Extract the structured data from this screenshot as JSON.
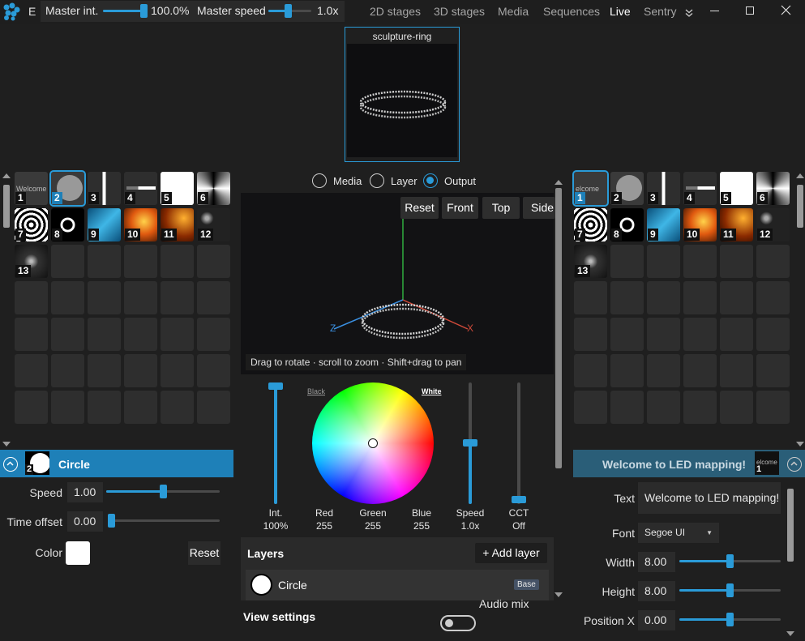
{
  "app": {
    "title_short": "E"
  },
  "master": {
    "int_label": "Master int.",
    "int_value": "100.0%",
    "int_fraction": 1.0,
    "speed_label": "Master speed",
    "speed_value": "1.0x",
    "speed_fraction": 0.5
  },
  "nav": {
    "items": [
      "2D stages",
      "3D stages",
      "Media",
      "Sequences",
      "Live",
      "Sentry"
    ],
    "active": "Live"
  },
  "preview": {
    "title": "sculpture-ring"
  },
  "view_mode": {
    "options": [
      "Media",
      "Layer",
      "Output"
    ],
    "selected": "Output"
  },
  "view_buttons": [
    "Reset",
    "Front",
    "Top",
    "Side"
  ],
  "viewport_hint": "Drag to rotate · scroll to zoom · Shift+drag to pan",
  "axes": {
    "x": "X",
    "z": "Z"
  },
  "left_grid": {
    "items": [
      "1",
      "2",
      "3",
      "4",
      "5",
      "6",
      "7",
      "8",
      "9",
      "10",
      "11",
      "12",
      "13"
    ],
    "selected": "2",
    "welcome_text": "Welcome"
  },
  "right_grid": {
    "items": [
      "1",
      "2",
      "3",
      "4",
      "5",
      "6",
      "7",
      "8",
      "9",
      "10",
      "11",
      "12",
      "13"
    ],
    "selected": "1",
    "welcome_text": "elcome"
  },
  "left_layer": {
    "title": "Circle",
    "num": "2",
    "speed_label": "Speed",
    "speed_value": "1.00",
    "speed_fraction": 0.5,
    "offset_label": "Time offset",
    "offset_value": "0.00",
    "offset_fraction": 0.0,
    "color_label": "Color",
    "reset_label": "Reset"
  },
  "color": {
    "black_label": "Black",
    "white_label": "White",
    "int_label": "Int.",
    "int_value": "100%",
    "int_fraction": 1.0,
    "red_label": "Red",
    "red_value": "255",
    "green_label": "Green",
    "green_value": "255",
    "blue_label": "Blue",
    "blue_value": "255",
    "speed_label": "Speed",
    "speed_value": "1.0x",
    "speed_fraction": 0.5,
    "cct_label": "CCT",
    "cct_value": "Off",
    "cct_fraction": 0.0
  },
  "layers": {
    "title": "Layers",
    "add_label": "+ Add layer",
    "items": [
      {
        "name": "Circle",
        "badge": "Base"
      }
    ]
  },
  "bottom": {
    "view_settings": "View settings",
    "audio_mix": "Audio mix"
  },
  "right_layer": {
    "title": "Welcome to LED mapping!",
    "num": "1",
    "thumb_text": "elcome",
    "text_label": "Text",
    "text_value": "Welcome to LED mapping!",
    "font_label": "Font",
    "font_value": "Segoe UI",
    "width_label": "Width",
    "width_value": "8.00",
    "width_fraction": 0.5,
    "height_label": "Height",
    "height_value": "8.00",
    "height_fraction": 0.5,
    "posx_label": "Position X",
    "posx_value": "0.00",
    "posx_fraction": 0.5
  },
  "colors": {
    "accent": "#2a9bd8",
    "header": "#1e80b8"
  }
}
